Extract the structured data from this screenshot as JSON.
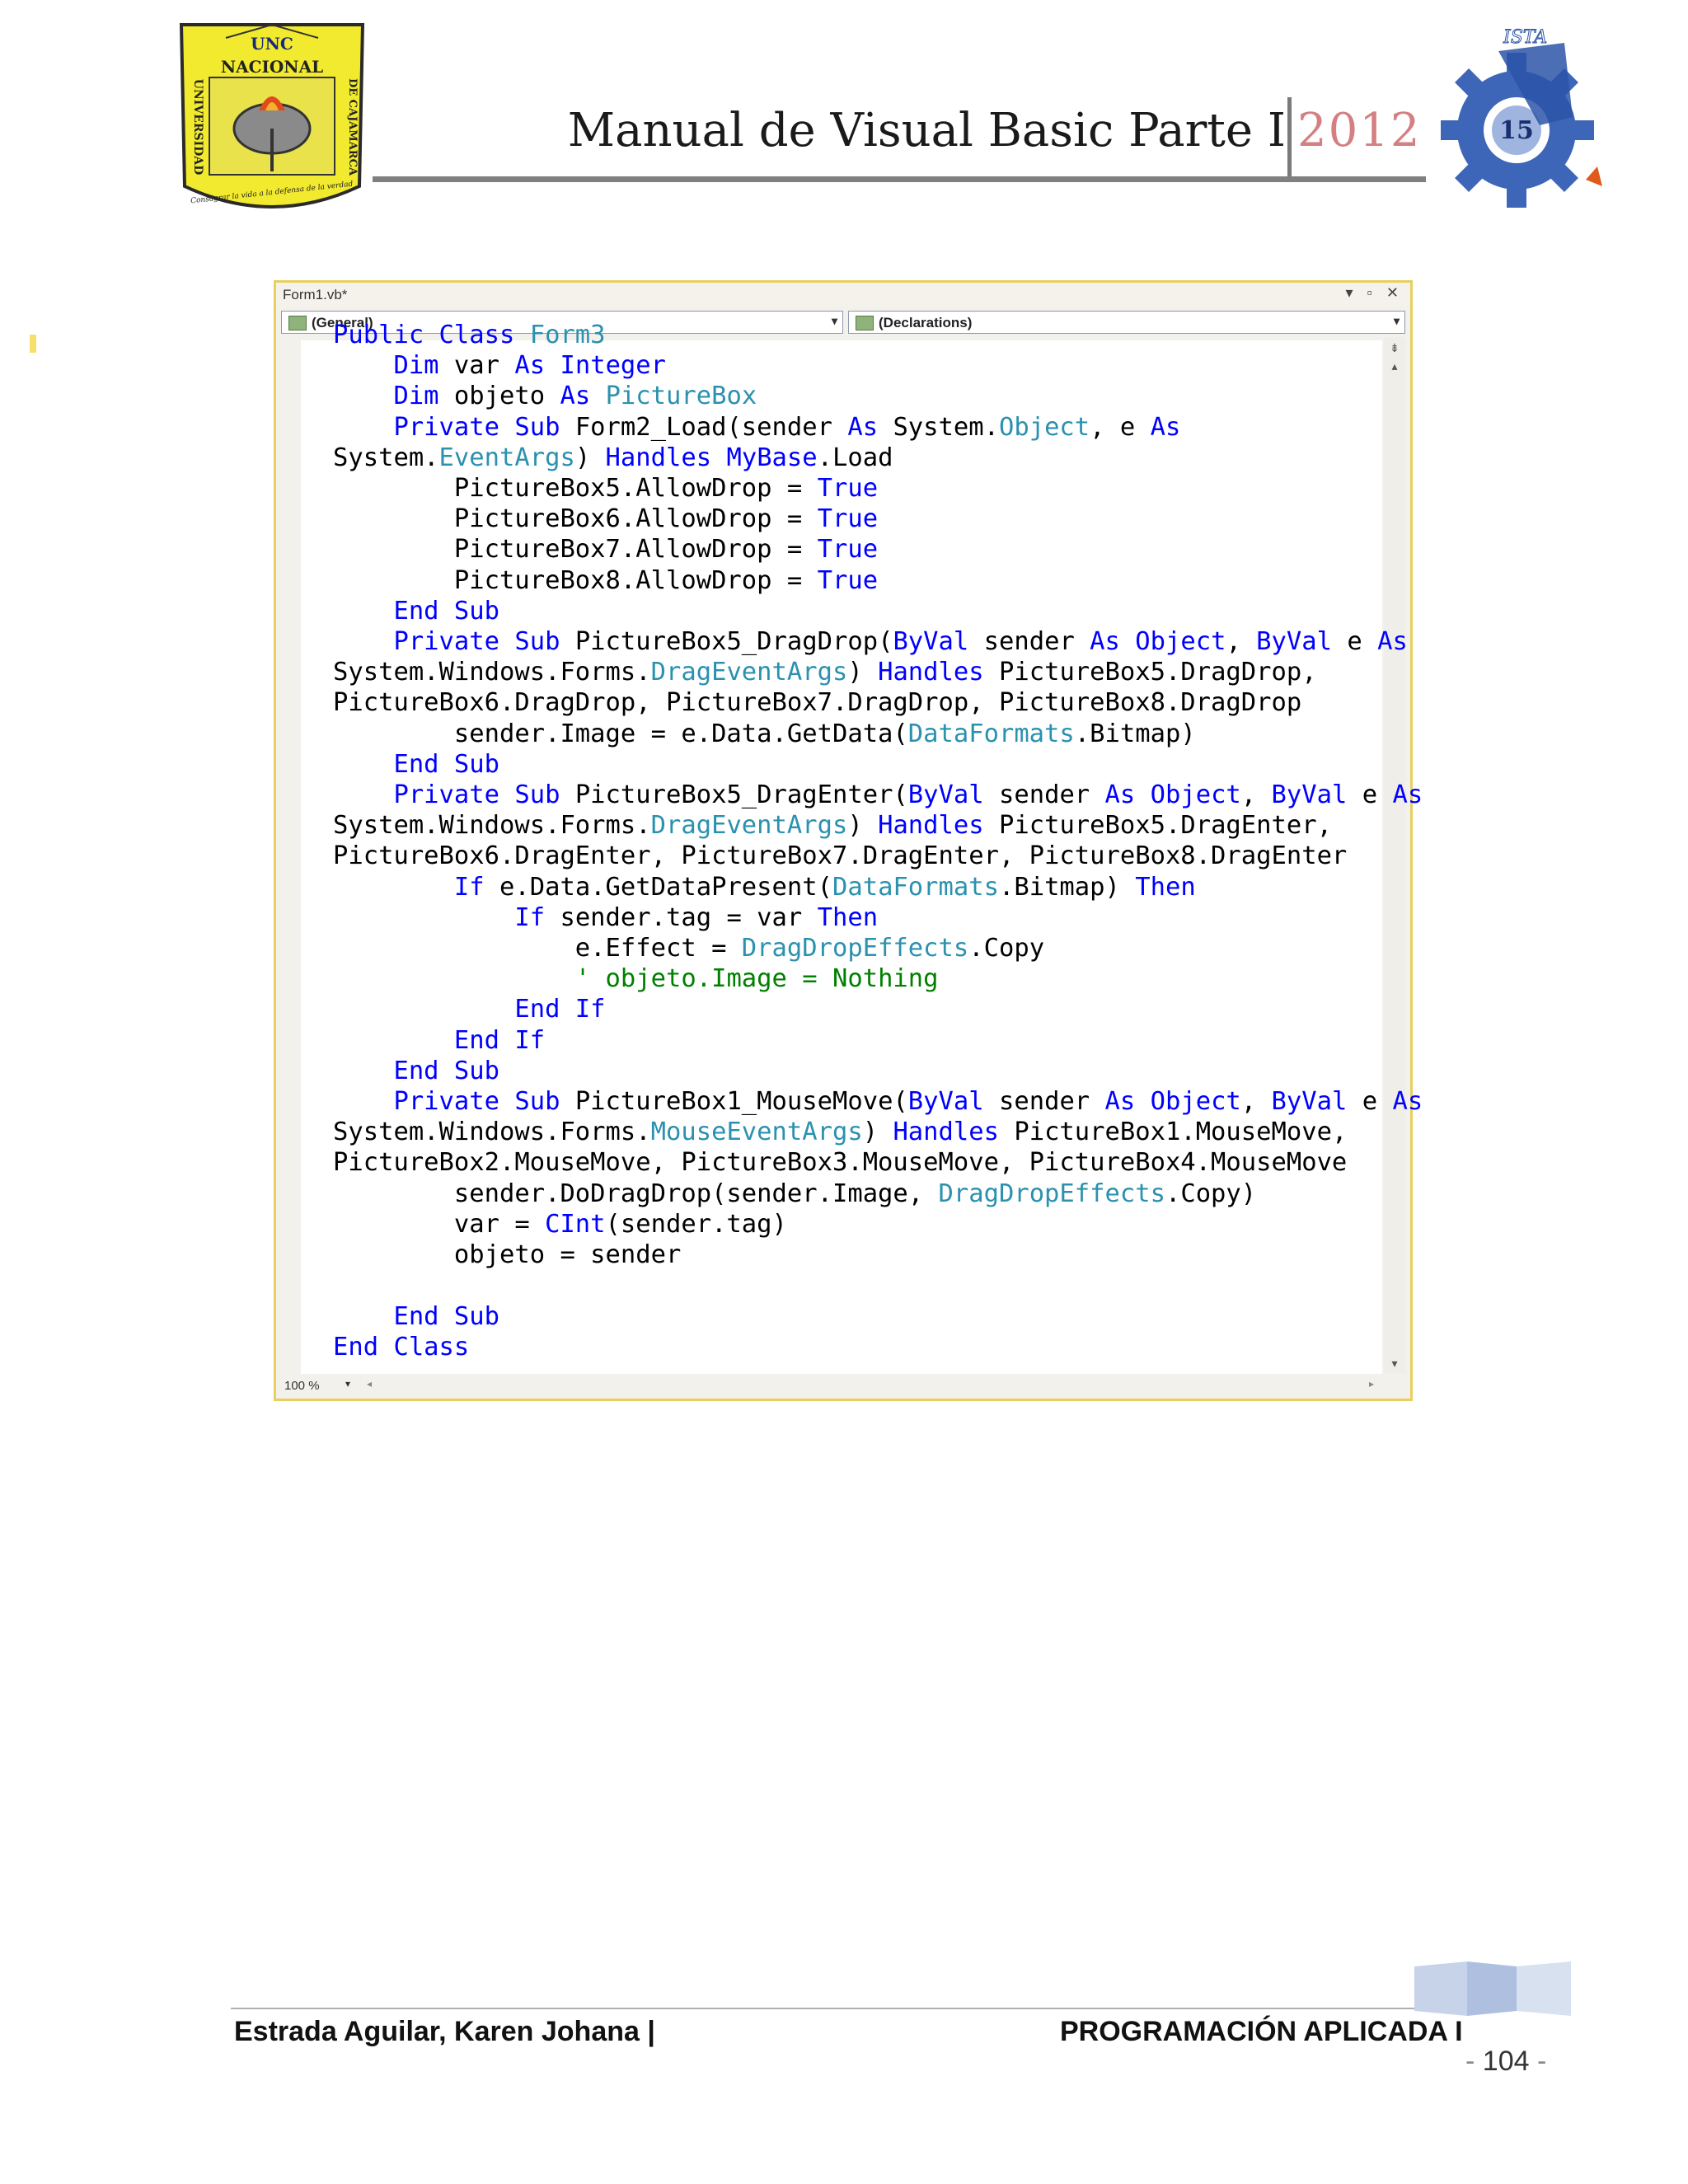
{
  "header": {
    "title": "Manual de Visual Basic Parte I",
    "year": "2012",
    "logo_left_text": {
      "top": "UNC",
      "name": "NACIONAL",
      "left_side": "UNIVERSIDAD",
      "right_side": "DE CAJAMARCA",
      "motto": "Consagrar la vida a la defensa de la verdad"
    },
    "logo_right_text": "ISTA"
  },
  "editor": {
    "tab_label": "Form1.vb*",
    "window_controls": "▾ ▫ ✕",
    "dropdown_left": "(General)",
    "dropdown_right": "(Declarations)",
    "zoom": "100 %",
    "code_lines": [
      [
        {
          "t": "Public Class ",
          "c": "kw"
        },
        {
          "t": "Form3",
          "c": "ty"
        }
      ],
      [
        {
          "t": "    "
        },
        {
          "t": "Dim",
          "c": "kw"
        },
        {
          "t": " var "
        },
        {
          "t": "As",
          "c": "kw"
        },
        {
          "t": " "
        },
        {
          "t": "Integer",
          "c": "kw"
        }
      ],
      [
        {
          "t": "    "
        },
        {
          "t": "Dim",
          "c": "kw"
        },
        {
          "t": " objeto "
        },
        {
          "t": "As",
          "c": "kw"
        },
        {
          "t": " "
        },
        {
          "t": "PictureBox",
          "c": "ty"
        }
      ],
      [
        {
          "t": "    "
        },
        {
          "t": "Private Sub",
          "c": "kw"
        },
        {
          "t": " Form2_Load(sender "
        },
        {
          "t": "As",
          "c": "kw"
        },
        {
          "t": " System."
        },
        {
          "t": "Object",
          "c": "ty"
        },
        {
          "t": ", e "
        },
        {
          "t": "As",
          "c": "kw"
        }
      ],
      [
        {
          "t": "System."
        },
        {
          "t": "EventArgs",
          "c": "ty"
        },
        {
          "t": ") "
        },
        {
          "t": "Handles",
          "c": "kw"
        },
        {
          "t": " "
        },
        {
          "t": "MyBase",
          "c": "kw"
        },
        {
          "t": ".Load"
        }
      ],
      [
        {
          "t": "        PictureBox5.AllowDrop = "
        },
        {
          "t": "True",
          "c": "kw"
        }
      ],
      [
        {
          "t": "        PictureBox6.AllowDrop = "
        },
        {
          "t": "True",
          "c": "kw"
        }
      ],
      [
        {
          "t": "        PictureBox7.AllowDrop = "
        },
        {
          "t": "True",
          "c": "kw"
        }
      ],
      [
        {
          "t": "        PictureBox8.AllowDrop = "
        },
        {
          "t": "True",
          "c": "kw"
        }
      ],
      [
        {
          "t": "    "
        },
        {
          "t": "End Sub",
          "c": "kw"
        }
      ],
      [
        {
          "t": "    "
        },
        {
          "t": "Private Sub",
          "c": "kw"
        },
        {
          "t": " PictureBox5_DragDrop("
        },
        {
          "t": "ByVal",
          "c": "kw"
        },
        {
          "t": " sender "
        },
        {
          "t": "As Object",
          "c": "kw"
        },
        {
          "t": ", "
        },
        {
          "t": "ByVal",
          "c": "kw"
        },
        {
          "t": " e "
        },
        {
          "t": "As",
          "c": "kw"
        }
      ],
      [
        {
          "t": "System.Windows.Forms."
        },
        {
          "t": "DragEventArgs",
          "c": "ty"
        },
        {
          "t": ") "
        },
        {
          "t": "Handles",
          "c": "kw"
        },
        {
          "t": " PictureBox5.DragDrop,"
        }
      ],
      [
        {
          "t": "PictureBox6.DragDrop, PictureBox7.DragDrop, PictureBox8.DragDrop"
        }
      ],
      [
        {
          "t": "        sender.Image = e.Data.GetData("
        },
        {
          "t": "DataFormats",
          "c": "ty"
        },
        {
          "t": ".Bitmap)"
        }
      ],
      [
        {
          "t": "    "
        },
        {
          "t": "End Sub",
          "c": "kw"
        }
      ],
      [
        {
          "t": "    "
        },
        {
          "t": "Private Sub",
          "c": "kw"
        },
        {
          "t": " PictureBox5_DragEnter("
        },
        {
          "t": "ByVal",
          "c": "kw"
        },
        {
          "t": " sender "
        },
        {
          "t": "As Object",
          "c": "kw"
        },
        {
          "t": ", "
        },
        {
          "t": "ByVal",
          "c": "kw"
        },
        {
          "t": " e "
        },
        {
          "t": "As",
          "c": "kw"
        }
      ],
      [
        {
          "t": "System.Windows.Forms."
        },
        {
          "t": "DragEventArgs",
          "c": "ty"
        },
        {
          "t": ") "
        },
        {
          "t": "Handles",
          "c": "kw"
        },
        {
          "t": " PictureBox5.DragEnter,"
        }
      ],
      [
        {
          "t": "PictureBox6.DragEnter, PictureBox7.DragEnter, PictureBox8.DragEnter"
        }
      ],
      [
        {
          "t": "        "
        },
        {
          "t": "If",
          "c": "kw"
        },
        {
          "t": " e.Data.GetDataPresent("
        },
        {
          "t": "DataFormats",
          "c": "ty"
        },
        {
          "t": ".Bitmap) "
        },
        {
          "t": "Then",
          "c": "kw"
        }
      ],
      [
        {
          "t": "            "
        },
        {
          "t": "If",
          "c": "kw"
        },
        {
          "t": " sender.tag = var "
        },
        {
          "t": "Then",
          "c": "kw"
        }
      ],
      [
        {
          "t": "                e.Effect = "
        },
        {
          "t": "DragDropEffects",
          "c": "ty"
        },
        {
          "t": ".Copy"
        }
      ],
      [
        {
          "t": "                "
        },
        {
          "t": "' objeto.Image = Nothing",
          "c": "cm"
        }
      ],
      [
        {
          "t": "            "
        },
        {
          "t": "End If",
          "c": "kw"
        }
      ],
      [
        {
          "t": "        "
        },
        {
          "t": "End If",
          "c": "kw"
        }
      ],
      [
        {
          "t": "    "
        },
        {
          "t": "End Sub",
          "c": "kw"
        }
      ],
      [
        {
          "t": "    "
        },
        {
          "t": "Private Sub",
          "c": "kw"
        },
        {
          "t": " PictureBox1_MouseMove("
        },
        {
          "t": "ByVal",
          "c": "kw"
        },
        {
          "t": " sender "
        },
        {
          "t": "As Object",
          "c": "kw"
        },
        {
          "t": ", "
        },
        {
          "t": "ByVal",
          "c": "kw"
        },
        {
          "t": " e "
        },
        {
          "t": "As",
          "c": "kw"
        }
      ],
      [
        {
          "t": "System.Windows.Forms."
        },
        {
          "t": "MouseEventArgs",
          "c": "ty"
        },
        {
          "t": ") "
        },
        {
          "t": "Handles",
          "c": "kw"
        },
        {
          "t": " PictureBox1.MouseMove,"
        }
      ],
      [
        {
          "t": "PictureBox2.MouseMove, PictureBox3.MouseMove, PictureBox4.MouseMove"
        }
      ],
      [
        {
          "t": "        sender.DoDragDrop(sender.Image, "
        },
        {
          "t": "DragDropEffects",
          "c": "ty"
        },
        {
          "t": ".Copy)"
        }
      ],
      [
        {
          "t": "        var = "
        },
        {
          "t": "CInt",
          "c": "kw"
        },
        {
          "t": "(sender.tag)"
        }
      ],
      [
        {
          "t": "        objeto = sender"
        }
      ],
      [
        {
          "t": ""
        }
      ],
      [
        {
          "t": "    "
        },
        {
          "t": "End Sub",
          "c": "kw"
        }
      ],
      [
        {
          "t": "End Class",
          "c": "kw"
        }
      ]
    ]
  },
  "footer": {
    "author": "Estrada Aguilar, Karen Johana |",
    "course": "PROGRAMACIÓN APLICADA I",
    "page_prefix": "- ",
    "page_number": "104",
    "page_suffix": " -"
  },
  "colors": {
    "keyword": "#0000ff",
    "type": "#2b91af",
    "comment": "#008000",
    "year": "#d47f82",
    "editor_border": "#e8cf5f"
  }
}
